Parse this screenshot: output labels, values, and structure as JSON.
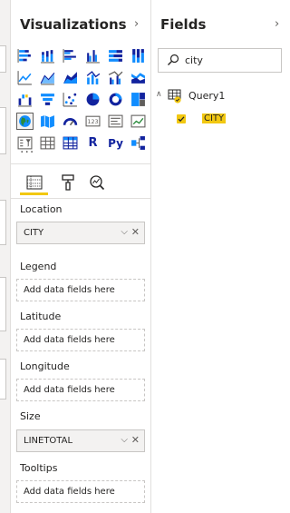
{
  "visualizations": {
    "title": "Visualizations",
    "collapse_icon": "chevron-right-icon",
    "more_label": "···",
    "icons": [
      "stacked-bar-chart-icon",
      "stacked-column-chart-icon",
      "clustered-bar-chart-icon",
      "clustered-column-chart-icon",
      "100-stacked-bar-chart-icon",
      "100-stacked-column-chart-icon",
      "line-chart-icon",
      "area-chart-icon",
      "stacked-area-chart-icon",
      "line-column-chart-icon",
      "line-clustered-column-chart-icon",
      "ribbon-chart-icon",
      "waterfall-chart-icon",
      "funnel-chart-icon",
      "scatter-chart-icon",
      "pie-chart-icon",
      "donut-chart-icon",
      "treemap-icon",
      "map-icon",
      "filled-map-icon",
      "gauge-icon",
      "card-icon",
      "multi-row-card-icon",
      "kpi-icon",
      "slicer-icon",
      "table-icon",
      "matrix-icon",
      "r-visual-icon",
      "python-visual-icon",
      "key-influencers-icon"
    ],
    "selected_index": 18,
    "r_label": "R",
    "py_label": "Py",
    "card_label": "123",
    "pane_tabs": [
      "fields-tab-icon",
      "format-paint-icon",
      "analytics-icon"
    ],
    "colors": {
      "accent": "#f2c811",
      "chart_blue": "#118dff",
      "chart_dark": "#12239e"
    }
  },
  "wells": {
    "location": {
      "label": "Location",
      "value": "CITY"
    },
    "legend": {
      "label": "Legend",
      "placeholder": "Add data fields here"
    },
    "latitude": {
      "label": "Latitude",
      "placeholder": "Add data fields here"
    },
    "longitude": {
      "label": "Longitude",
      "placeholder": "Add data fields here"
    },
    "size": {
      "label": "Size",
      "value": "LINETOTAL"
    },
    "tooltips": {
      "label": "Tooltips",
      "placeholder": "Add data fields here"
    }
  },
  "fields": {
    "title": "Fields",
    "search_value": "city",
    "table_name": "Query1",
    "field_name": "CITY"
  }
}
